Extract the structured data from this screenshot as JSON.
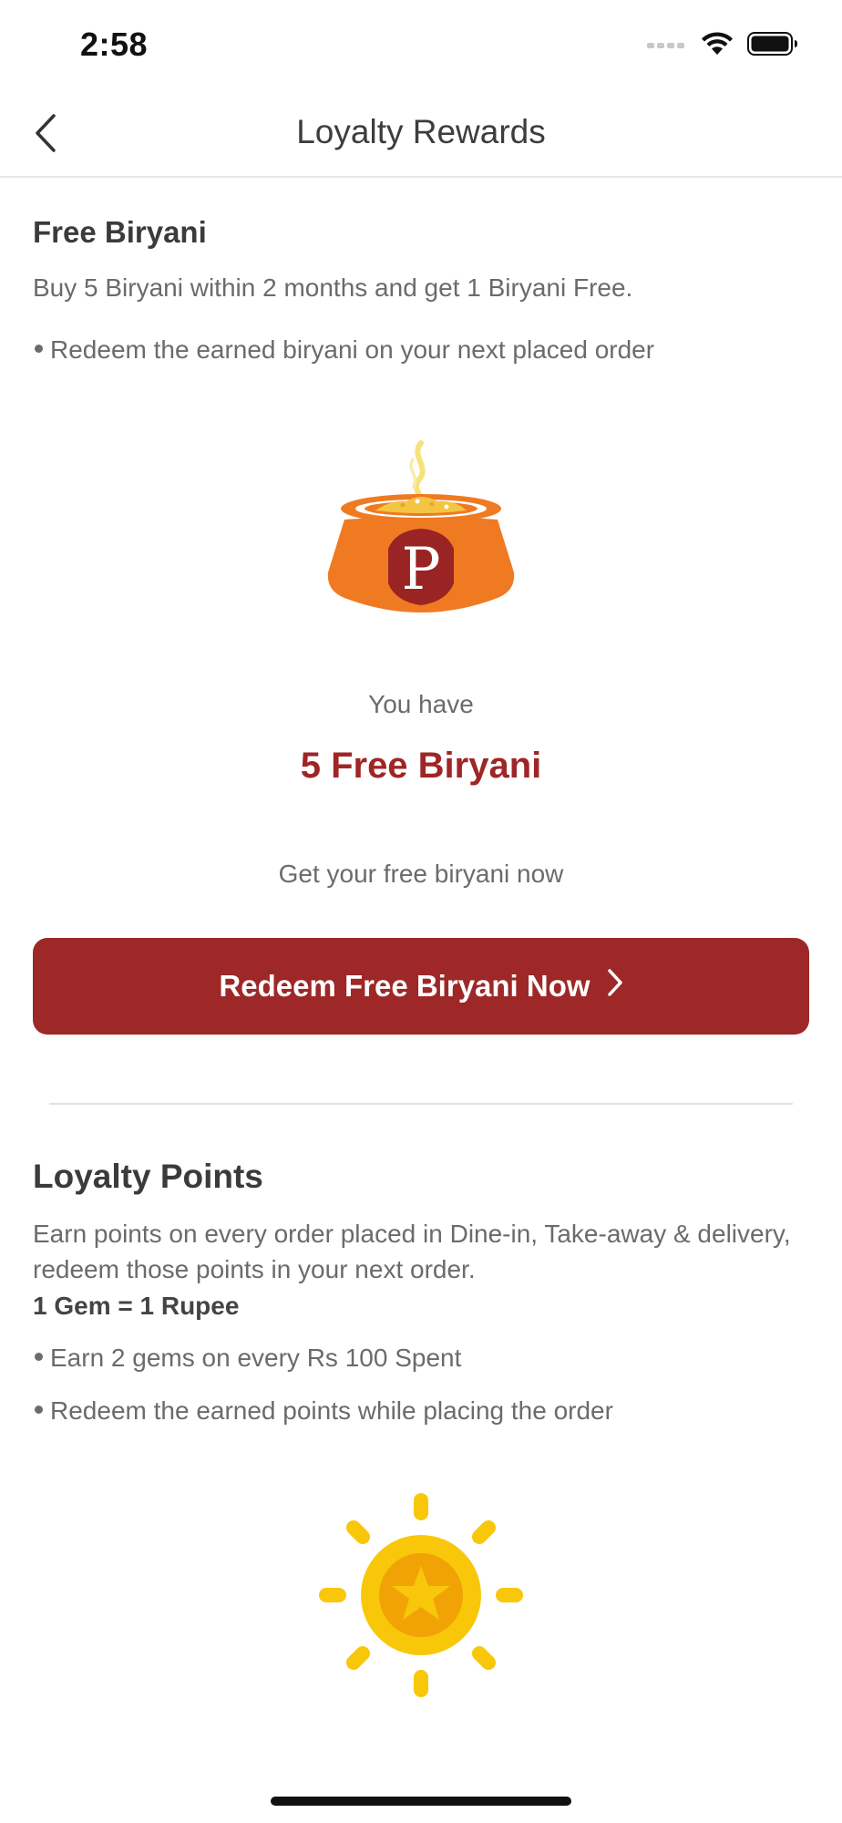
{
  "status_bar": {
    "time": "2:58",
    "icons": [
      "cellular-signal-icon",
      "wifi-icon",
      "battery-icon"
    ]
  },
  "header": {
    "title": "Loyalty Rewards",
    "back_icon": "chevron-left-icon"
  },
  "free_biryani": {
    "title": "Free Biryani",
    "description": "Buy 5 Biryani within 2 months and get 1 Biryani Free.",
    "bullets": [
      "Redeem the earned biryani on your next placed order"
    ],
    "illustration": "biryani-pot-icon",
    "you_have_label": "You have",
    "count_label": "5 Free Biryani",
    "prompt": "Get your free biryani now",
    "redeem_button_label": "Redeem Free Biryani Now",
    "redeem_button_icon": "chevron-right-icon"
  },
  "loyalty_points": {
    "title": "Loyalty Points",
    "description": "Earn points on every order placed in Dine-in, Take-away & delivery, redeem those points in your next order.",
    "conversion": "1 Gem = 1 Rupee",
    "bullets": [
      "Earn 2 gems on every Rs 100 Spent",
      "Redeem the earned points while placing the order"
    ],
    "illustration": "gem-coin-icon"
  },
  "colors": {
    "accent": "#9e2727",
    "accent_text": "#9f2626",
    "pot_orange": "#f07a22",
    "coin_yellow": "#f9c70a",
    "coin_orange": "#f1a306",
    "body_text": "#6b6b6b",
    "title_text": "#3b3b3b"
  }
}
